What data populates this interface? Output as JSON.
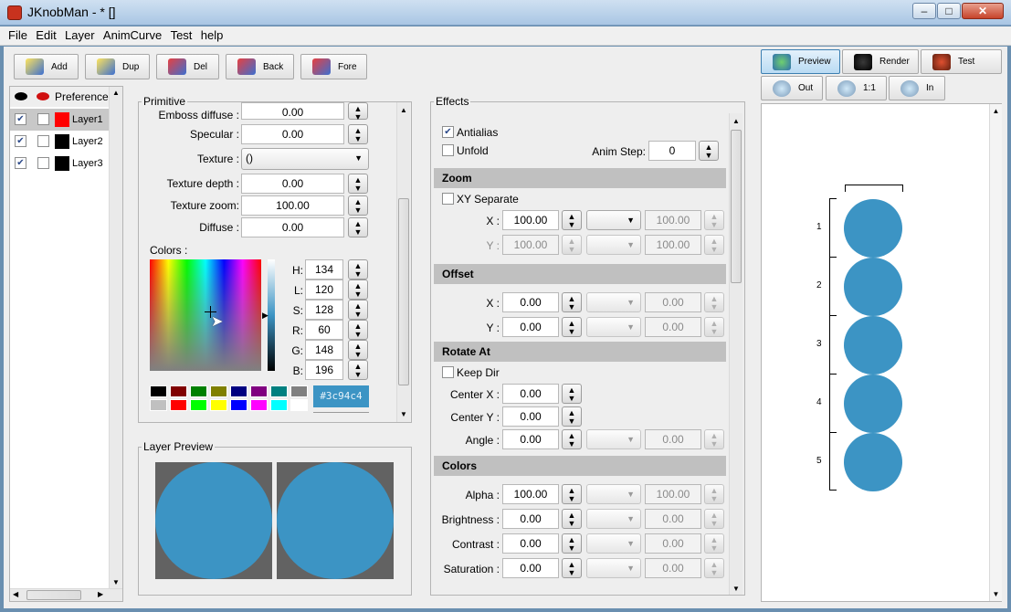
{
  "window": {
    "title": "JKnobMan - * []"
  },
  "menu": [
    "File",
    "Edit",
    "Layer",
    "AnimCurve",
    "Test",
    "help"
  ],
  "toolbar": {
    "add": "Add",
    "dup": "Dup",
    "del": "Del",
    "back": "Back",
    "fore": "Fore"
  },
  "right_toolbar": {
    "preview": "Preview",
    "render": "Render",
    "test": "Test",
    "out": "Out",
    "one": "1:1",
    "in": "In"
  },
  "layers": {
    "header": "Preference",
    "items": [
      {
        "name": "Layer1",
        "color": "#ff0000",
        "checked": true
      },
      {
        "name": "Layer2",
        "color": "#000000",
        "checked": true
      },
      {
        "name": "Layer3",
        "color": "#000000",
        "checked": true
      }
    ]
  },
  "primitive": {
    "title": "Primitive",
    "emboss_label": "Emboss diffuse :",
    "emboss_value": "0.00",
    "specular_label": "Specular :",
    "specular_value": "0.00",
    "texture_label": "Texture :",
    "texture_value": "()",
    "texdepth_label": "Texture depth :",
    "texdepth_value": "0.00",
    "texzoom_label": "Texture zoom:",
    "texzoom_value": "100.00",
    "diffuse_label": "Diffuse :",
    "diffuse_value": "0.00",
    "colors_label": "Colors :",
    "hsl": [
      {
        "label": "H:",
        "value": "134"
      },
      {
        "label": "L:",
        "value": "120"
      },
      {
        "label": "S:",
        "value": "128"
      },
      {
        "label": "R:",
        "value": "60"
      },
      {
        "label": "G:",
        "value": "148"
      },
      {
        "label": "B:",
        "value": "196"
      }
    ],
    "hex": "#3c94c4",
    "swatches": [
      "#000000",
      "#800000",
      "#008000",
      "#808000",
      "#000080",
      "#800080",
      "#008080",
      "#808080",
      "#c0c0c0",
      "#ff0000",
      "#00ff00",
      "#ffff00",
      "#0000ff",
      "#ff00ff",
      "#00ffff",
      "#ffffff"
    ]
  },
  "layer_preview": {
    "title": "Layer Preview"
  },
  "effects": {
    "title": "Effects",
    "antialias": "Antialias",
    "unfold": "Unfold",
    "animstep_label": "Anim Step:",
    "animstep_value": "0",
    "zoom": {
      "title": "Zoom",
      "xy_separate": "XY Separate",
      "x_label": "X :",
      "x_value": "100.00",
      "x_end": "100.00",
      "y_label": "Y :",
      "y_value": "100.00",
      "y_end": "100.00"
    },
    "offset": {
      "title": "Offset",
      "x_label": "X :",
      "x_value": "0.00",
      "x_end": "0.00",
      "y_label": "Y :",
      "y_value": "0.00",
      "y_end": "0.00"
    },
    "rotate": {
      "title": "Rotate At",
      "keep_dir": "Keep Dir",
      "cx_label": "Center X :",
      "cx_value": "0.00",
      "cy_label": "Center Y :",
      "cy_value": "0.00",
      "angle_label": "Angle :",
      "angle_value": "0.00",
      "angle_end": "0.00"
    },
    "colors": {
      "title": "Colors",
      "alpha_label": "Alpha :",
      "alpha_value": "100.00",
      "alpha_end": "100.00",
      "bright_label": "Brightness :",
      "bright_value": "0.00",
      "bright_end": "0.00",
      "contrast_label": "Contrast :",
      "contrast_value": "0.00",
      "contrast_end": "0.00",
      "sat_label": "Saturation :",
      "sat_value": "0.00",
      "sat_end": "0.00"
    }
  },
  "preview_frames": [
    "1",
    "2",
    "3",
    "4",
    "5"
  ],
  "accent_color": "#3c94c4"
}
